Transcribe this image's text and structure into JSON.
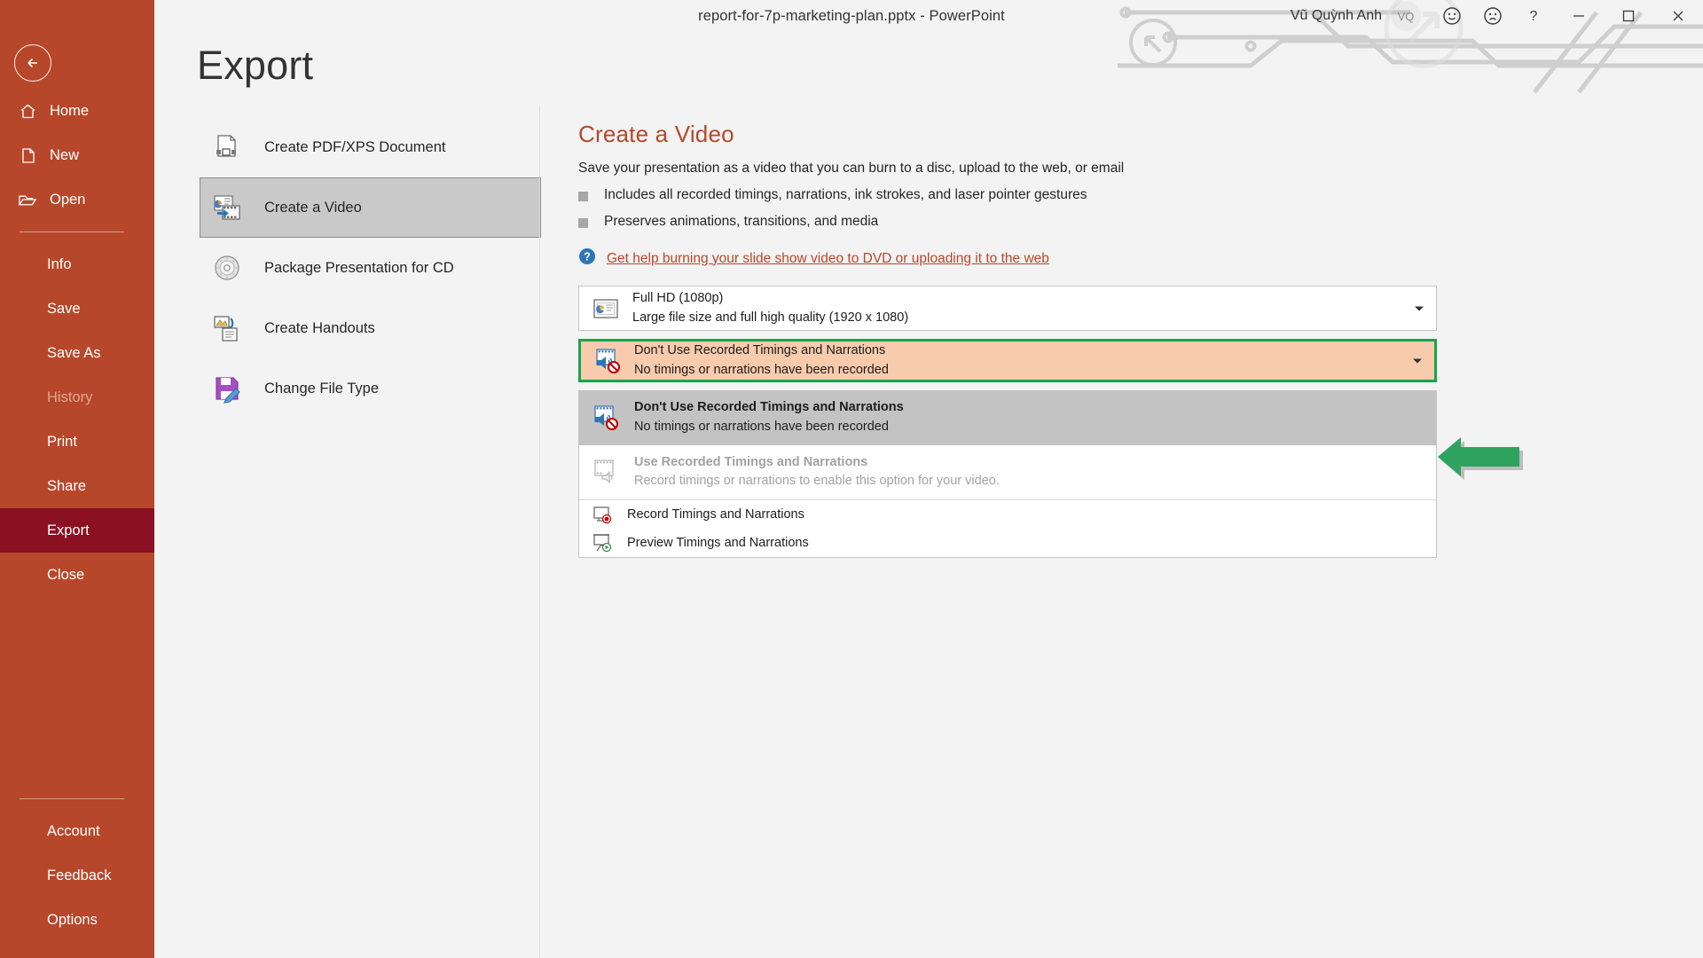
{
  "window": {
    "title": "report-for-7p-marketing-plan.pptx  -  PowerPoint",
    "user_name": "Vũ Quỳnh Anh",
    "user_initials": "VQ",
    "icons": {
      "smile": "smiley-face-icon",
      "frown": "frowny-face-icon",
      "help": "help-question-icon",
      "minimize": "minimize-icon",
      "maximize": "maximize-icon",
      "close": "close-icon"
    }
  },
  "backstage": {
    "back_label": "back-arrow-icon",
    "page_title": "Export",
    "nav_top": [
      {
        "label": "Home",
        "icon": "home-icon"
      },
      {
        "label": "New",
        "icon": "new-document-icon"
      },
      {
        "label": "Open",
        "icon": "open-folder-icon"
      }
    ],
    "nav_main": [
      {
        "label": "Info",
        "state": "normal"
      },
      {
        "label": "Save",
        "state": "normal"
      },
      {
        "label": "Save As",
        "state": "normal"
      },
      {
        "label": "History",
        "state": "disabled"
      },
      {
        "label": "Print",
        "state": "normal"
      },
      {
        "label": "Share",
        "state": "normal"
      },
      {
        "label": "Export",
        "state": "active"
      },
      {
        "label": "Close",
        "state": "normal"
      }
    ],
    "nav_bottom": [
      {
        "label": "Account"
      },
      {
        "label": "Feedback"
      },
      {
        "label": "Options"
      }
    ]
  },
  "export_commands": [
    {
      "label": "Create PDF/XPS Document",
      "icon": "pdf-document-icon",
      "selected": false
    },
    {
      "label": "Create a Video",
      "icon": "create-video-icon",
      "selected": true
    },
    {
      "label": "Package Presentation for CD",
      "icon": "cd-disc-icon",
      "selected": false
    },
    {
      "label": "Create Handouts",
      "icon": "handouts-icon",
      "selected": false
    },
    {
      "label": "Change File Type",
      "icon": "save-file-type-icon",
      "selected": false
    }
  ],
  "detail": {
    "heading": "Create a Video",
    "subtitle": "Save your presentation as a video that you can burn to a disc, upload to the web, or email",
    "bullets": [
      "Includes all recorded timings, narrations, ink strokes, and laser pointer gestures",
      "Preserves animations, transitions, and media"
    ],
    "help_link": "Get help burning your slide show video to DVD or uploading it to the web"
  },
  "dropdowns": {
    "quality": {
      "icon": "slide-quality-icon",
      "line1": "Full HD (1080p)",
      "line2": "Large file size and full high quality (1920 x 1080)",
      "caret": "chevron-down-icon",
      "expanded": false
    },
    "timings": {
      "icon": "film-no-audio-icon",
      "line1": "Don't Use Recorded Timings and Narrations",
      "line2": "No timings or narrations have been recorded",
      "caret": "chevron-down-icon",
      "expanded": true,
      "highlight_border_color": "#14A64B",
      "highlight_fill_color": "#F8CBAD"
    }
  },
  "menu_items": [
    {
      "type": "rich",
      "icon": "film-no-audio-icon",
      "state": "selected",
      "line1": "Don't Use Recorded Timings and Narrations",
      "line2": "No timings or narrations have been recorded"
    },
    {
      "type": "rich",
      "icon": "film-audio-icon",
      "state": "disabled",
      "line1": "Use Recorded Timings and Narrations",
      "line2": "Record timings or narrations to enable this option for your video."
    },
    {
      "type": "simple",
      "icon": "record-timings-icon",
      "state": "normal",
      "label": "Record Timings and Narrations"
    },
    {
      "type": "simple",
      "icon": "preview-timings-icon",
      "state": "normal",
      "label": "Preview Timings and Narrations"
    }
  ],
  "annotation": {
    "arrow": "green-left-arrow-annotation",
    "color": "#2EA35F"
  },
  "theme": {
    "rail_bg": "#B7472A",
    "rail_active_bg": "#8A1022",
    "accent": "#B7472A",
    "page_bg": "#F3F3F3"
  }
}
